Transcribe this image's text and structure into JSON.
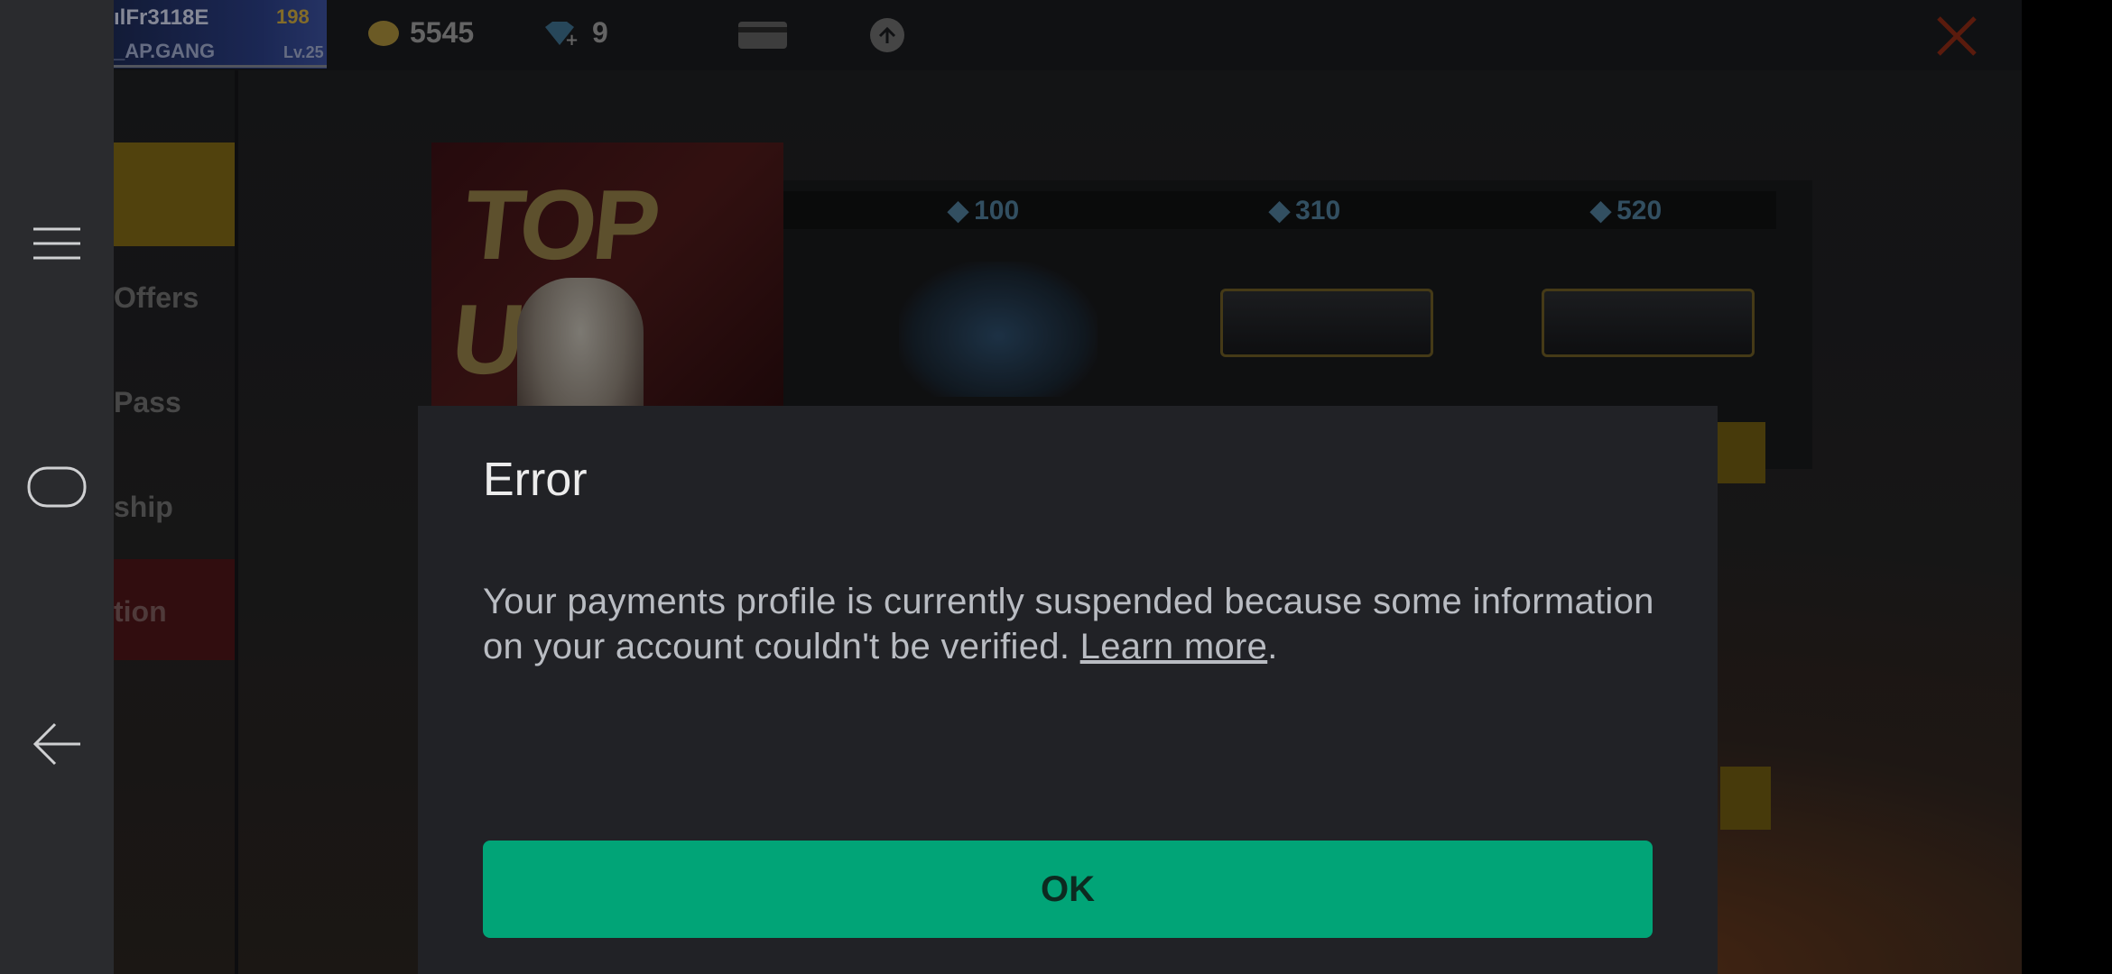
{
  "game": {
    "profile": {
      "name": "ılFr3118E",
      "gang": "_AP.GANG",
      "coin_badge": "198",
      "level": "Lv.25"
    },
    "currency": {
      "gold": "5545",
      "diamonds": "9"
    },
    "sidebar": {
      "items": [
        "Offers",
        "Pass",
        "ship",
        "tion"
      ]
    },
    "banner": {
      "text": "TOP UP"
    },
    "shop": {
      "packages": [
        "100",
        "310",
        "520"
      ]
    },
    "accent_color": "#7d6614"
  },
  "dialog": {
    "title": "Error",
    "body": "Your payments profile is currently suspended because some information on your account couldn't be verified. ",
    "link_label": "Learn more",
    "body_end": ".",
    "ok_label": "OK",
    "button_color": "#01a477"
  },
  "navbar": {
    "icons": [
      "menu-icon",
      "home-icon",
      "back-icon"
    ]
  }
}
